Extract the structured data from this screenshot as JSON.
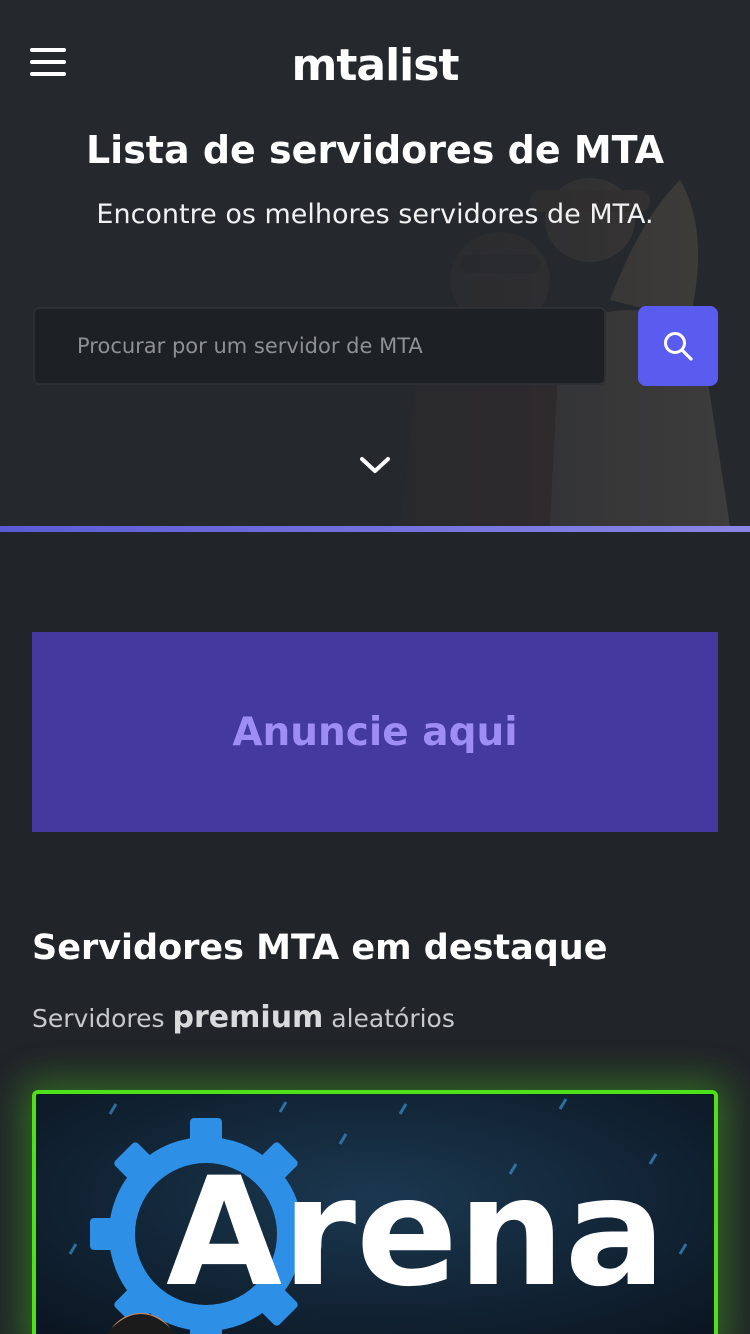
{
  "header": {
    "logo_text": "mtalist"
  },
  "hero": {
    "title": "Lista de servidores de MTA",
    "subtitle": "Encontre os melhores servidores de MTA.",
    "search_placeholder": "Procurar por um servidor de MTA"
  },
  "ad": {
    "label": "Anuncie aqui"
  },
  "featured": {
    "title": "Servidores MTA em destaque",
    "subtitle_before": "Servidores",
    "subtitle_bold": "premium",
    "subtitle_after": "aleatórios",
    "card_banner_text": "Arena"
  },
  "colors": {
    "accent": "#5a5cf0",
    "ad_background": "#43399e",
    "ad_text": "#9d8df4",
    "card_border": "#4fe01c"
  },
  "icons": {
    "menu": "hamburger-icon",
    "search": "search-icon",
    "scroll": "chevron-down-icon"
  }
}
